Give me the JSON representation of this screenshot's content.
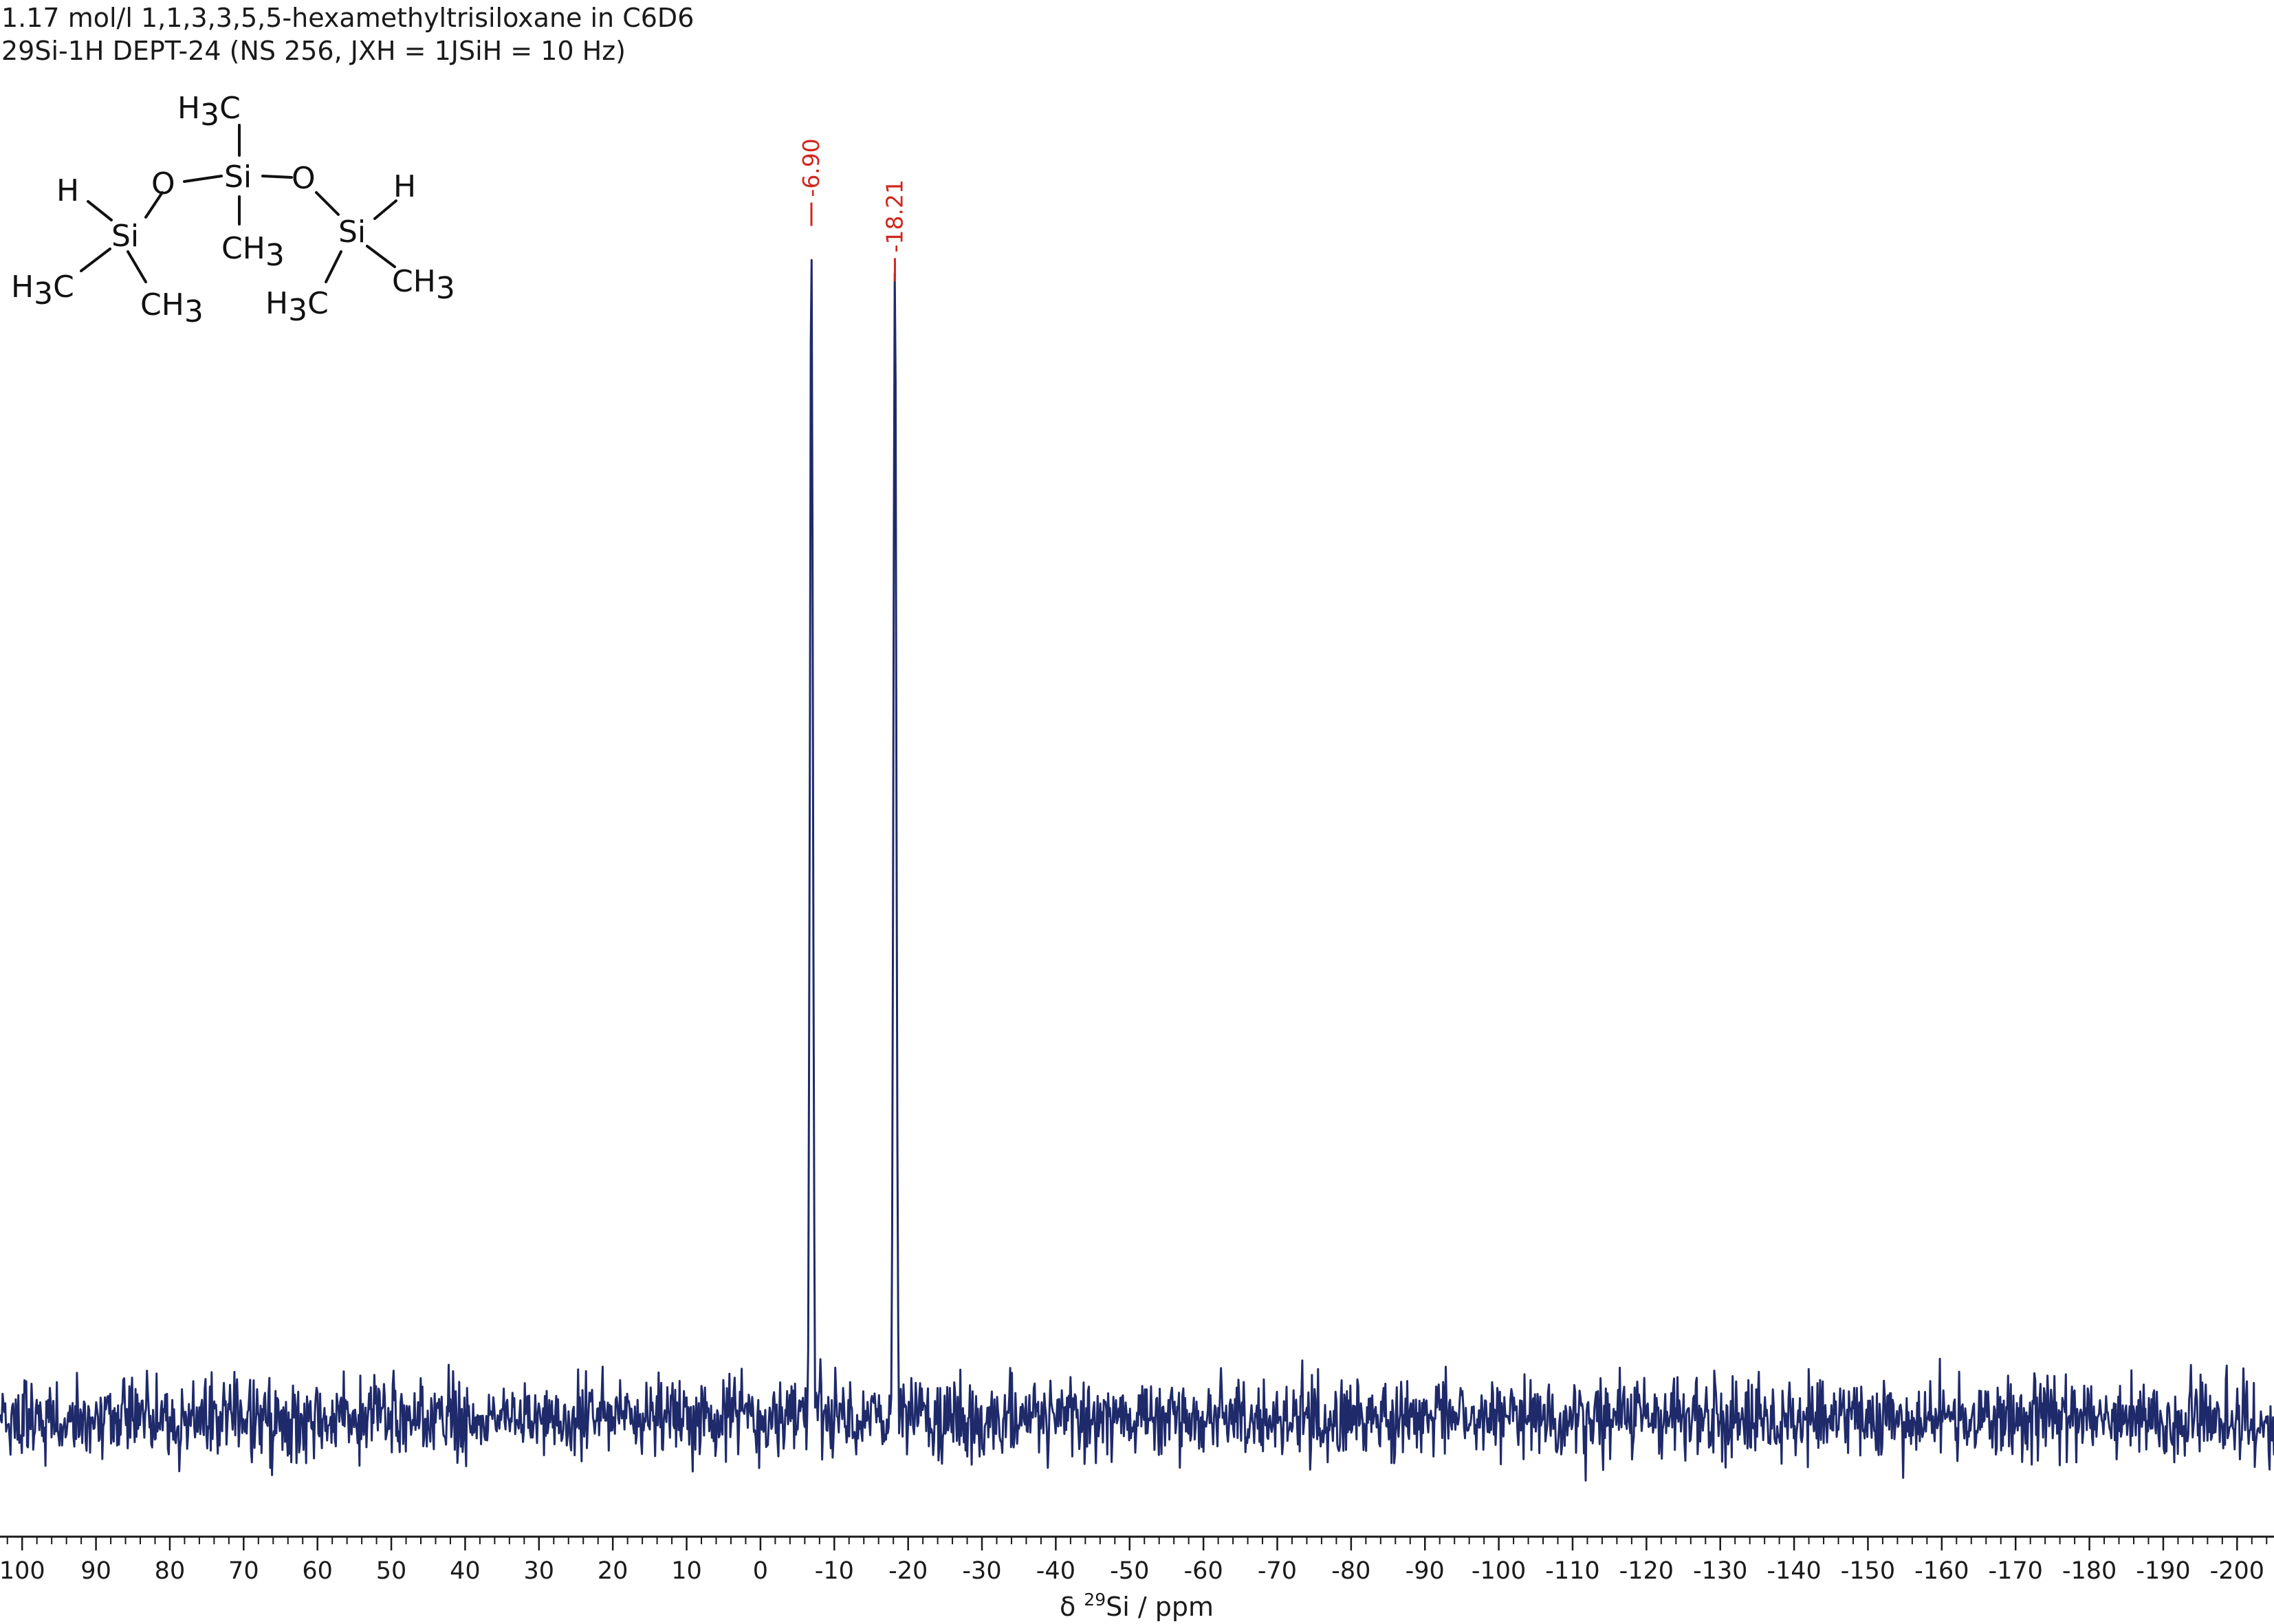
{
  "header": {
    "line1": "1.17 mol/l 1,1,3,3,5,5-hexamethyltrisiloxane in C6D6",
    "line2": "29Si-1H DEPT-24 (NS 256, JXH = 1JSiH = 10 Hz)"
  },
  "structure": {
    "atoms": [
      "H",
      "O",
      "Si",
      "O",
      "H",
      "Si",
      "Si"
    ],
    "groups": [
      "H3C",
      "CH3",
      "H3C",
      "CH3",
      "H3C",
      "CH3"
    ]
  },
  "chart_data": {
    "type": "line",
    "title": "",
    "xlabel_prefix": "δ ",
    "xlabel_sup": "29",
    "xlabel_rest": "Si / ppm",
    "xlim": [
      103,
      -205
    ],
    "x_reversed": true,
    "ylim": [
      -0.3,
      3.4
    ],
    "ticks_major": [
      100,
      90,
      80,
      70,
      60,
      50,
      40,
      30,
      20,
      10,
      0,
      -10,
      -20,
      -30,
      -40,
      -50,
      -60,
      -70,
      -80,
      -90,
      -100,
      -110,
      -120,
      -130,
      -140,
      -150,
      -160,
      -170,
      -180,
      -190,
      -200
    ],
    "tick_labels": [
      "100",
      "90",
      "80",
      "70",
      "60",
      "50",
      "40",
      "30",
      "20",
      "10",
      "0",
      "-10",
      "-20",
      "-30",
      "-40",
      "-50",
      "-60",
      "-70",
      "-80",
      "-90",
      "-100",
      "-110",
      "-120",
      "-130",
      "-140",
      "-150",
      "-160",
      "-170",
      "-180",
      "-190",
      "-200"
    ],
    "minor_tick_step": 2,
    "baseline": 0,
    "noise_amplitude": 0.13,
    "peaks": [
      {
        "shift": -6.9,
        "label": "-6.90",
        "intensity": 2.99
      },
      {
        "shift": -18.21,
        "label": "-18.21",
        "intensity": 2.85
      }
    ],
    "colors": {
      "spectrum": "#1f2a6b",
      "peak_label": "#d0271e",
      "axis": "#1a1a1a"
    },
    "grid": false,
    "legend": "none"
  }
}
